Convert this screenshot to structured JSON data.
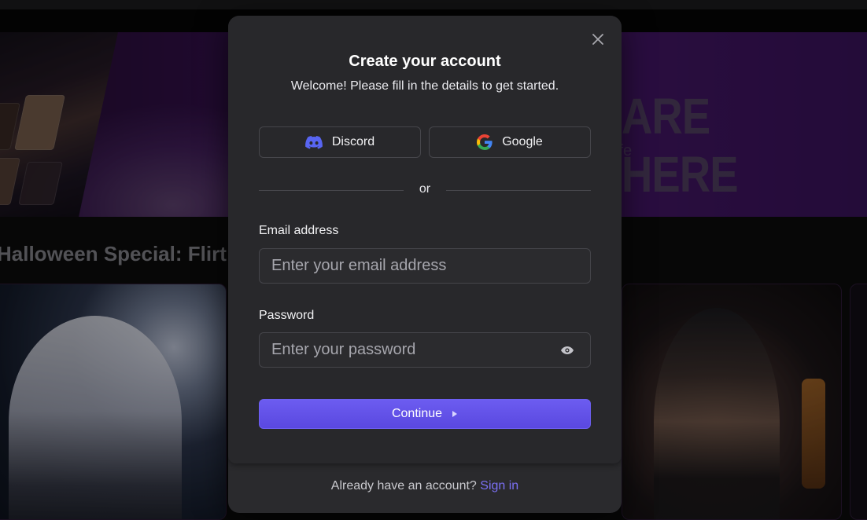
{
  "background": {
    "hero_title": "ARE HERE",
    "hero_subtitle": "ife",
    "section_title": "Halloween Special: Flirt w"
  },
  "modal": {
    "title": "Create your account",
    "subtitle": "Welcome! Please fill in the details to get started.",
    "close_icon": "close-icon",
    "social": {
      "discord_label": "Discord",
      "google_label": "Google",
      "discord_color": "#5865F2"
    },
    "divider_text": "or",
    "email": {
      "label": "Email address",
      "placeholder": "Enter your email address",
      "value": ""
    },
    "password": {
      "label": "Password",
      "placeholder": "Enter your password",
      "value": "",
      "toggle_icon": "eye-icon"
    },
    "continue_label": "Continue",
    "continue_icon": "caret-right-icon",
    "footer": {
      "prompt": "Already have an account?",
      "link": "Sign in"
    },
    "colors": {
      "accent": "#5b4ae6",
      "link": "#7b70f5",
      "modal_bg": "#28282b"
    }
  }
}
